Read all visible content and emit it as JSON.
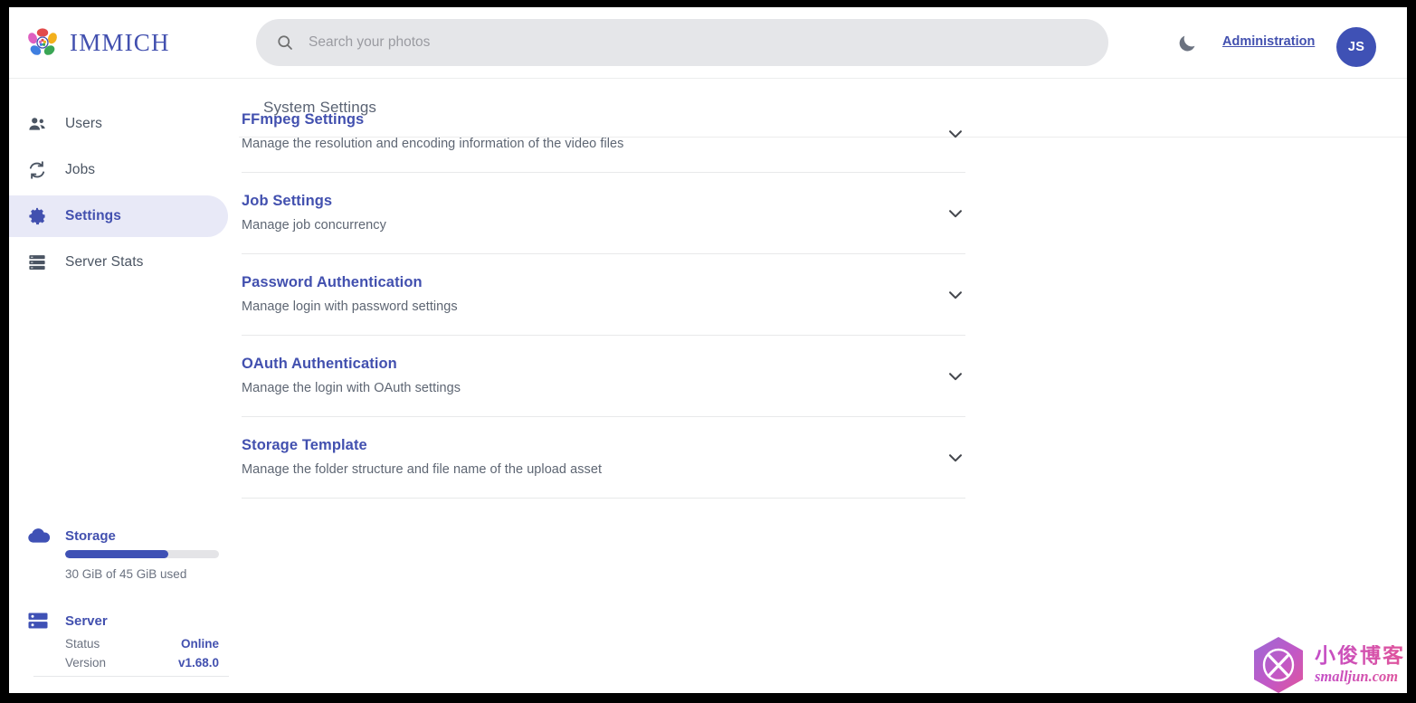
{
  "app": {
    "brand_name": "IMMICH",
    "accent_color": "#4250af",
    "avatar_color": "#3f51b5"
  },
  "topbar": {
    "logo_icon": "immich-flower-logo",
    "search": {
      "icon": "search-icon",
      "placeholder": "Search your photos",
      "value": ""
    },
    "theme_toggle_icon": "moon-icon",
    "administration_label": "Administration",
    "avatar_initials": "JS"
  },
  "sidebar": {
    "items": [
      {
        "label": "Users",
        "icon": "users-icon",
        "active": false
      },
      {
        "label": "Jobs",
        "icon": "sync-refresh-icon",
        "active": false
      },
      {
        "label": "Settings",
        "icon": "gear-icon",
        "active": true
      },
      {
        "label": "Server Stats",
        "icon": "server-rack-icon",
        "active": false
      }
    ],
    "storage": {
      "icon": "cloud-icon",
      "title": "Storage",
      "used_percent": 67,
      "caption": "30 GiB of 45 GiB used"
    },
    "server": {
      "icon": "server-icon",
      "title": "Server",
      "rows": [
        {
          "key": "Status",
          "value": "Online"
        },
        {
          "key": "Version",
          "value": "v1.68.0"
        }
      ]
    }
  },
  "main": {
    "page_title": "System Settings",
    "settings": [
      {
        "name": "FFmpeg Settings",
        "description": "Manage the resolution and encoding information of the video files",
        "toggle_icon": "chevron-down-icon"
      },
      {
        "name": "Job Settings",
        "description": "Manage job concurrency",
        "toggle_icon": "chevron-down-icon"
      },
      {
        "name": "Password Authentication",
        "description": "Manage login with password settings",
        "toggle_icon": "chevron-down-icon"
      },
      {
        "name": "OAuth Authentication",
        "description": "Manage the login with OAuth settings",
        "toggle_icon": "chevron-down-icon"
      },
      {
        "name": "Storage Template",
        "description": "Manage the folder structure and file name of the upload asset",
        "toggle_icon": "chevron-down-icon"
      }
    ]
  },
  "watermark": {
    "logo_icon": "hexagon-x-logo",
    "title_cn": "小俊博客",
    "url": "smalljun.com"
  }
}
